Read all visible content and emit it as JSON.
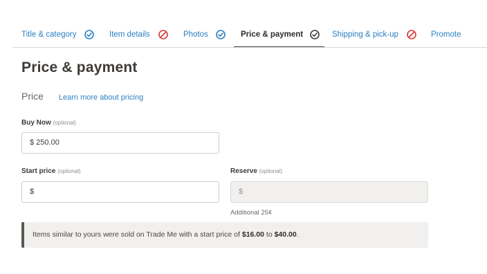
{
  "tabs": [
    {
      "label": "Title & category",
      "icon": "check-circle-icon",
      "status": "complete"
    },
    {
      "label": "Item details",
      "icon": "prohibited-icon",
      "status": "error"
    },
    {
      "label": "Photos",
      "icon": "check-circle-icon",
      "status": "complete"
    },
    {
      "label": "Price & payment",
      "icon": "check-circle-icon",
      "status": "current"
    },
    {
      "label": "Shipping & pick-up",
      "icon": "prohibited-icon",
      "status": "error"
    },
    {
      "label": "Promote",
      "icon": "",
      "status": "none"
    }
  ],
  "page_title": "Price & payment",
  "price": {
    "heading": "Price",
    "learn_more": "Learn more about pricing"
  },
  "buy_now": {
    "label": "Buy Now",
    "optional": "(optional)",
    "value": "$ 250.00"
  },
  "start_price": {
    "label": "Start price",
    "optional": "(optional)",
    "value": "$"
  },
  "reserve": {
    "label": "Reserve",
    "optional": "(optional)",
    "value": "$",
    "helper": "Additional 25¢"
  },
  "notice": {
    "prefix": "Items similar to yours were sold on Trade Me with a start price of ",
    "low": "$16.00",
    "middle": " to ",
    "high": "$40.00",
    "suffix": "."
  },
  "colors": {
    "link": "#2a7fc2",
    "complete": "#2a7fc2",
    "error": "#d93838",
    "text": "#4a4744"
  }
}
